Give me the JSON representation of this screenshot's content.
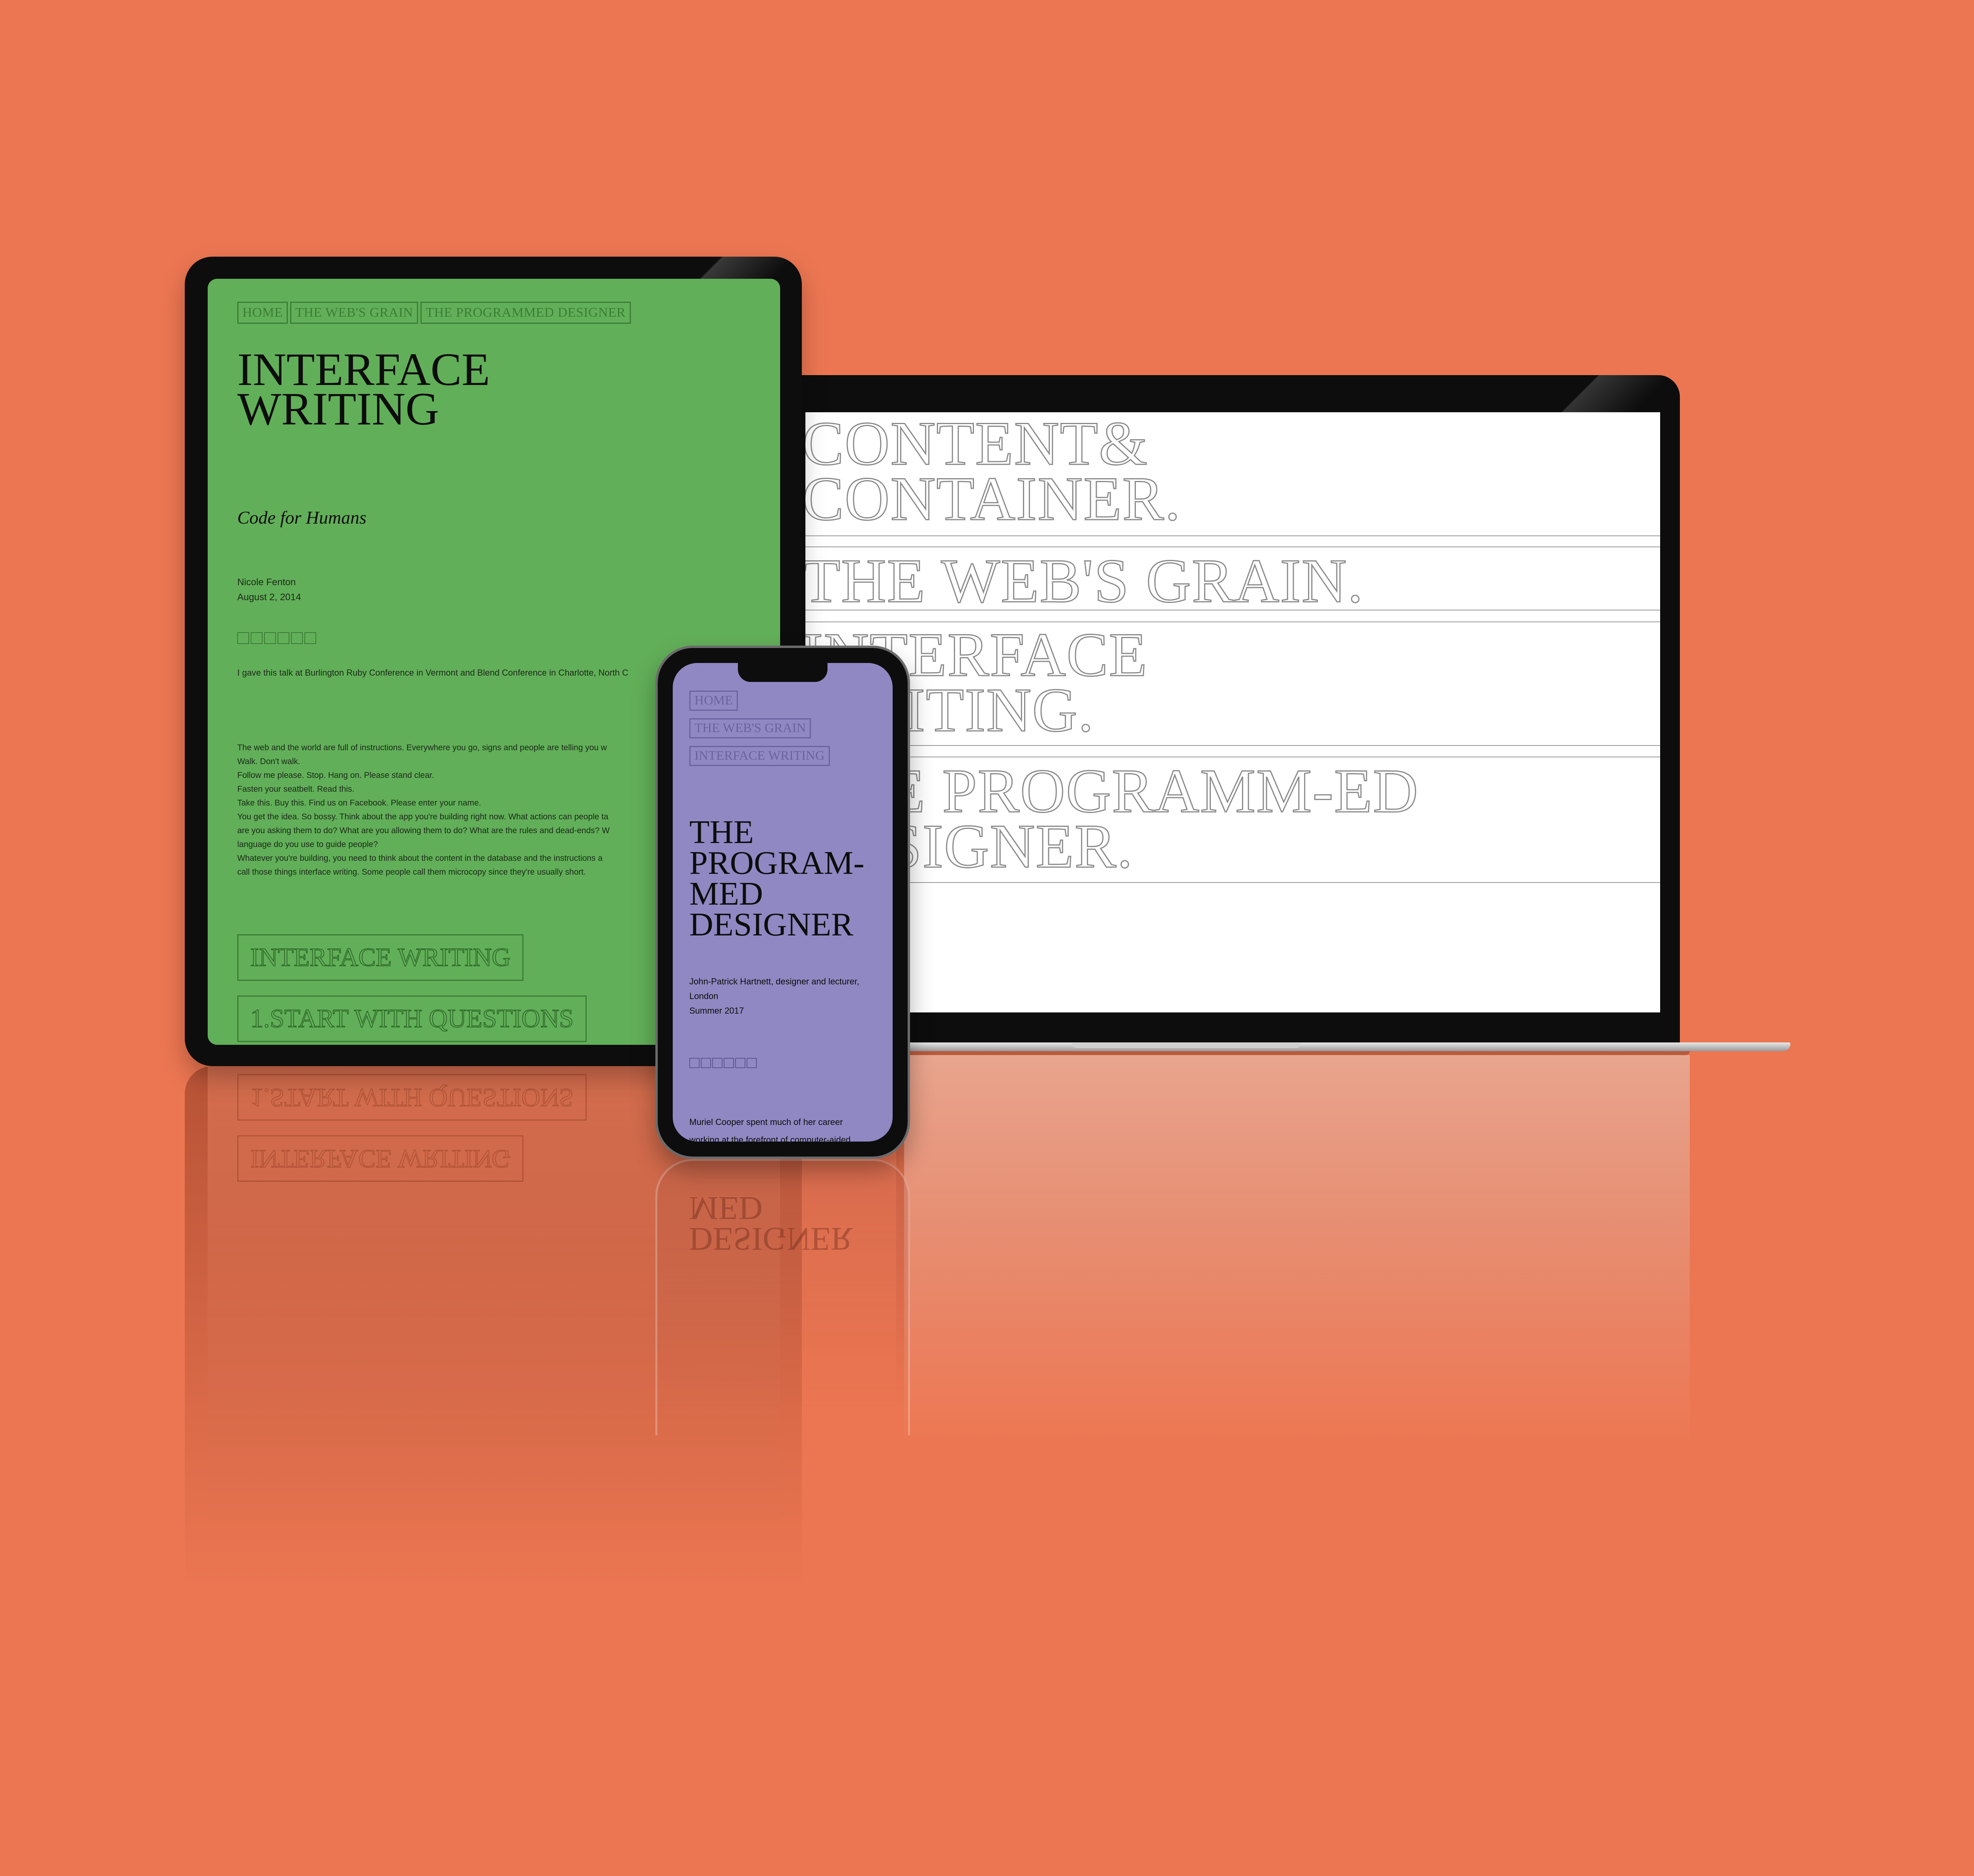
{
  "background_color": "#EC7652",
  "tablet": {
    "screen_color": "#62AF59",
    "nav": [
      "HOME",
      "THE WEB'S GRAIN",
      "THE PROGRAMMED DESIGNER"
    ],
    "title_line1": "INTERFACE",
    "title_line2": "WRITING",
    "subtitle": "Code for Humans",
    "author": "Nicole Fenton",
    "date": "August 2, 2014",
    "intro": "I gave this talk at Burlington Ruby Conference in Vermont and Blend Conference in Charlotte, North C",
    "body": [
      "The web and the world are full of instructions. Everywhere you go, signs and people are telling you w",
      "Walk. Don't walk.",
      "Follow me please. Stop. Hang on. Please stand clear.",
      "Fasten your seatbelt. Read this.",
      "Take this. Buy this. Find us on Facebook. Please enter your name.",
      "You get the idea. So bossy. Think about the app you're building right now. What actions can people ta",
      "are you asking them to do? What are you allowing them to do? What are the rules and dead-ends? W",
      "language do you use to guide people?",
      "Whatever you're building, you need to think about the content in the database and the instructions a",
      "call those things interface writing. Some people call them microcopy since they're usually short."
    ],
    "section1": "INTERFACE WRITING",
    "section2": "1.START WITH QUESTIONS"
  },
  "laptop": {
    "screen_color": "#FFFFFF",
    "items": [
      {
        "line1": "CONTENT&",
        "line2": "CONTAINER."
      },
      {
        "line1": "THE WEB'S GRAIN."
      },
      {
        "line1": "INTERFACE",
        "line2": "WRITING."
      },
      {
        "line1": "THE PROGRAMM-ED",
        "line2": "DESIGNER."
      }
    ]
  },
  "phone": {
    "screen_color": "#9088C2",
    "nav": [
      "HOME",
      "THE WEB'S GRAIN",
      "INTERFACE WRITING"
    ],
    "title_line1": "THE",
    "title_line2": "PROGRAM-",
    "title_line3": "MED",
    "title_line4": "DESIGNER",
    "author_line1": "John-Patrick Hartnett, designer and lecturer,",
    "author_line2": "London",
    "date": "Summer 2017",
    "body_line1": "Muriel Cooper spent much of her career",
    "body_line2": "working at the forefront of computer-aided"
  }
}
